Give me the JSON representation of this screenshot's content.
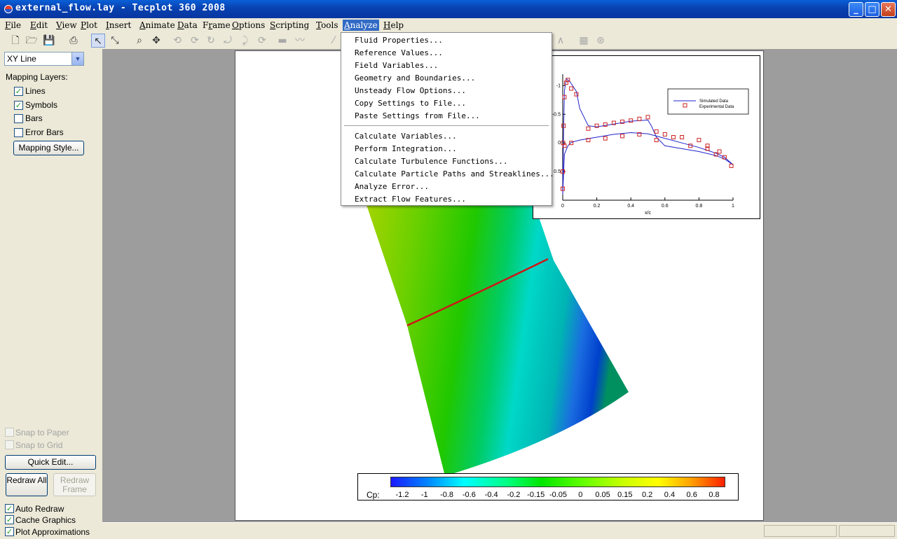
{
  "window": {
    "title": "external_flow.lay - Tecplot 360 2008",
    "controls": [
      "_",
      "□",
      "✕"
    ]
  },
  "menubar": [
    {
      "label": "File",
      "u": "F",
      "rest": "ile"
    },
    {
      "label": "Edit",
      "u": "E",
      "rest": "dit"
    },
    {
      "label": "View",
      "u": "V",
      "rest": "iew"
    },
    {
      "label": "Plot",
      "u": "P",
      "rest": "lot"
    },
    {
      "label": "Insert",
      "u": "I",
      "rest": "nsert"
    },
    {
      "label": "Animate",
      "u": "A",
      "rest": "nimate"
    },
    {
      "label": "Data",
      "u": "D",
      "rest": "ata"
    },
    {
      "label": "Frame",
      "pre": "F",
      "u": "r",
      "rest": "ame"
    },
    {
      "label": "Options",
      "u": "O",
      "rest": "ptions"
    },
    {
      "label": "Scripting",
      "u": "S",
      "rest": "cripting"
    },
    {
      "label": "Tools",
      "u": "T",
      "rest": "ools"
    },
    {
      "label": "Analyze",
      "u": "A",
      "rest": "nalyze"
    },
    {
      "label": "Help",
      "u": "H",
      "rest": "elp"
    }
  ],
  "analyze_menu": {
    "group1": [
      "Fluid Properties...",
      "Reference Values...",
      "Field Variables...",
      "Geometry and Boundaries...",
      "Unsteady Flow Options...",
      "Copy Settings to File...",
      "Paste Settings from File..."
    ],
    "group2": [
      "Calculate Variables...",
      "Perform Integration...",
      "Calculate Turbulence Functions...",
      "Calculate Particle Paths and Streaklines...",
      "Analyze Error...",
      "Extract Flow Features..."
    ]
  },
  "sidebar": {
    "plot_type": "XY Line",
    "mapping_layers_label": "Mapping Layers:",
    "layers": [
      {
        "label": "Lines",
        "checked": true
      },
      {
        "label": "Symbols",
        "checked": true
      },
      {
        "label": "Bars",
        "checked": false
      },
      {
        "label": "Error Bars",
        "checked": false
      }
    ],
    "mapping_style_btn": "Mapping Style...",
    "snap_to_paper": "Snap to Paper",
    "snap_to_grid": "Snap to Grid",
    "quick_edit_btn": "Quick Edit...",
    "redraw_all_btn": "Redraw All",
    "redraw_frame_btn": "Redraw Frame",
    "auto_redraw": "Auto Redraw",
    "cache_graphics": "Cache Graphics",
    "plot_approximations": "Plot Approximations"
  },
  "toolbar_icons": [
    "new-file-icon",
    "open-folder-icon",
    "save-icon",
    "print-icon",
    "select-arrow-icon",
    "adjustor-icon",
    "zoom-icon",
    "translate-icon",
    "rotate-icon",
    "spherical-rotate-icon",
    "roll-icon",
    "twist-icon",
    "probe-icon",
    "rotate-3d-icon",
    "slice-icon",
    "streamtrace-icon",
    "contour-add-icon",
    "grid-icon",
    "polar-icon",
    "line-icon"
  ],
  "colorbar": {
    "label": "Cp:",
    "ticks": [
      "-1.2",
      "-1",
      "-0.8",
      "-0.6",
      "-0.4",
      "-0.2",
      "-0.15",
      "-0.05",
      "0",
      "0.05",
      "0.15",
      "0.2",
      "0.4",
      "0.6",
      "0.8"
    ]
  },
  "chart_data": {
    "type": "scatter",
    "xlabel": "x/c",
    "ylabel": "",
    "xlim": [
      0,
      1
    ],
    "ylim": [
      1,
      -1.2
    ],
    "x_ticks": [
      "0",
      "0.2",
      "0.4",
      "0.6",
      "0.8",
      "1"
    ],
    "y_ticks": [
      "-1",
      "-0.5",
      "0",
      "0.5"
    ],
    "legend_position": "top-right",
    "series": [
      {
        "name": "Simulated Data",
        "kind": "line",
        "color": "#2222cc",
        "upper": [
          [
            0.0,
            0.9
          ],
          [
            0.005,
            -0.2
          ],
          [
            0.01,
            -0.9
          ],
          [
            0.02,
            -1.12
          ],
          [
            0.04,
            -1.08
          ],
          [
            0.08,
            -0.9
          ],
          [
            0.1,
            -0.6
          ],
          [
            0.15,
            -0.3
          ],
          [
            0.2,
            -0.28
          ],
          [
            0.3,
            -0.33
          ],
          [
            0.4,
            -0.38
          ],
          [
            0.5,
            -0.4
          ],
          [
            0.52,
            -0.3
          ],
          [
            0.55,
            -0.1
          ],
          [
            0.6,
            0.05
          ],
          [
            0.7,
            0.1
          ],
          [
            0.8,
            0.15
          ],
          [
            0.9,
            0.22
          ],
          [
            0.95,
            0.28
          ],
          [
            1.0,
            0.38
          ]
        ],
        "lower": [
          [
            0.0,
            0.9
          ],
          [
            0.01,
            0.2
          ],
          [
            0.03,
            0.05
          ],
          [
            0.05,
            -0.01
          ],
          [
            0.1,
            -0.05
          ],
          [
            0.2,
            -0.1
          ],
          [
            0.3,
            -0.15
          ],
          [
            0.4,
            -0.18
          ],
          [
            0.5,
            -0.16
          ],
          [
            0.6,
            -0.08
          ],
          [
            0.7,
            0.0
          ],
          [
            0.8,
            0.08
          ],
          [
            0.9,
            0.18
          ],
          [
            0.95,
            0.25
          ],
          [
            1.0,
            0.38
          ]
        ]
      },
      {
        "name": "Experimental Data",
        "kind": "markers",
        "color": "#cc2222",
        "points": [
          [
            0.0,
            0.8
          ],
          [
            0.0,
            0.5
          ],
          [
            0.002,
            0.0
          ],
          [
            0.005,
            -0.3
          ],
          [
            0.01,
            -0.8
          ],
          [
            0.02,
            -1.05
          ],
          [
            0.03,
            -1.1
          ],
          [
            0.05,
            -0.95
          ],
          [
            0.08,
            -0.85
          ],
          [
            0.15,
            -0.25
          ],
          [
            0.2,
            -0.3
          ],
          [
            0.25,
            -0.32
          ],
          [
            0.3,
            -0.35
          ],
          [
            0.35,
            -0.37
          ],
          [
            0.4,
            -0.39
          ],
          [
            0.45,
            -0.42
          ],
          [
            0.5,
            -0.45
          ],
          [
            0.55,
            -0.2
          ],
          [
            0.6,
            -0.15
          ],
          [
            0.65,
            -0.1
          ],
          [
            0.7,
            -0.1
          ],
          [
            0.8,
            -0.05
          ],
          [
            0.85,
            0.05
          ],
          [
            0.9,
            0.2
          ],
          [
            0.95,
            0.25
          ],
          [
            0.99,
            0.4
          ],
          [
            0.01,
            0.05
          ],
          [
            0.05,
            0.0
          ],
          [
            0.15,
            -0.05
          ],
          [
            0.25,
            -0.08
          ],
          [
            0.35,
            -0.12
          ],
          [
            0.45,
            -0.15
          ],
          [
            0.55,
            -0.05
          ],
          [
            0.75,
            0.05
          ],
          [
            0.85,
            0.1
          ],
          [
            0.92,
            0.15
          ]
        ]
      }
    ]
  }
}
